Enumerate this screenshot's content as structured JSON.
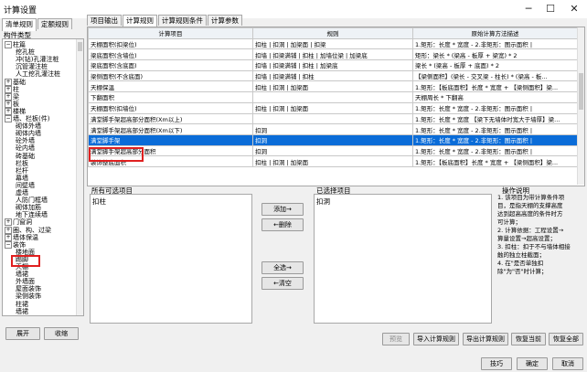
{
  "window": {
    "title": "计算设置",
    "min_icon": "minimize-icon",
    "max_icon": "maximize-icon",
    "close_icon": "close-icon"
  },
  "left_tabs": [
    "清单规则",
    "定额规则"
  ],
  "left_header": "构件类型",
  "tree": [
    {
      "label": "柱篇",
      "level": 0,
      "box": "−"
    },
    {
      "label": "挖孔桩",
      "level": 2
    },
    {
      "label": "冲(钻)孔灌注桩",
      "level": 2
    },
    {
      "label": "沉管灌注桩",
      "level": 2
    },
    {
      "label": "人工挖孔灌注桩",
      "level": 2
    },
    {
      "label": "基础",
      "level": 0,
      "box": "+"
    },
    {
      "label": "柱",
      "level": 0,
      "box": "+"
    },
    {
      "label": "梁",
      "level": 0,
      "box": "+"
    },
    {
      "label": "板",
      "level": 0,
      "box": "+"
    },
    {
      "label": "楼梯",
      "level": 0,
      "box": "+"
    },
    {
      "label": "墙、栏板(件)",
      "level": 0,
      "box": "−"
    },
    {
      "label": "砌体外墙",
      "level": 2
    },
    {
      "label": "砌体内墙",
      "level": 2
    },
    {
      "label": "砼外墙",
      "level": 2
    },
    {
      "label": "砼内墙",
      "level": 2
    },
    {
      "label": "砖基础",
      "level": 2
    },
    {
      "label": "栏板",
      "level": 2
    },
    {
      "label": "栏杆",
      "level": 2
    },
    {
      "label": "幕墙",
      "level": 2
    },
    {
      "label": "间壁墙",
      "level": 2
    },
    {
      "label": "虚墙",
      "level": 2
    },
    {
      "label": "人防门框墙",
      "level": 2
    },
    {
      "label": "砌体加筋",
      "level": 2
    },
    {
      "label": "地下连续墙",
      "level": 2
    },
    {
      "label": "门窗洞",
      "level": 0,
      "box": "+"
    },
    {
      "label": "圈、构、过梁",
      "level": 0,
      "box": "+"
    },
    {
      "label": "墙体保温",
      "level": 0,
      "box": "+"
    },
    {
      "label": "装饰",
      "level": 0,
      "box": "−"
    },
    {
      "label": "楼地面",
      "level": 2
    },
    {
      "label": "踢脚",
      "level": 2
    },
    {
      "label": "天棚",
      "level": 2
    },
    {
      "label": "墙裙",
      "level": 2
    },
    {
      "label": "外墙面",
      "level": 2
    },
    {
      "label": "屋面装饰",
      "level": 2
    },
    {
      "label": "梁侧装饰",
      "level": 2
    },
    {
      "label": "柱裙",
      "level": 2
    },
    {
      "label": "墙裙",
      "level": 2
    }
  ],
  "left_buttons": {
    "expand": "展开",
    "collapse": "收缩"
  },
  "right_tabs": [
    "项目输出",
    "计算规则",
    "计算规则条件",
    "计算参数"
  ],
  "grid": {
    "headers": [
      "计算项目",
      "规则",
      "原始计算方法描述"
    ],
    "rows": [
      [
        "天棚面积(扣梁位)",
        "扣柱 | 扣洞 | 加梁面 | 扣梁",
        "1.矩形：长度 * 宽度 - 2.非矩形：图示面积 |"
      ],
      [
        "梁底面积(含墙位)",
        "扣墙 | 扣梁满铺 | 扣柱 | 加墙位梁 | 加梁底",
        "矩形：梁长 * (梁高 - 板厚 + 梁宽) * 2"
      ],
      [
        "梁底面积(含底面)",
        "扣墙 | 扣梁满铺 | 扣柱 | 加梁底",
        "梁长 * (梁高 - 板厚 + 底面) * 2"
      ],
      [
        "梁侧面积(不含底面)",
        "扣墙 | 扣梁满铺 | 扣柱",
        "【梁侧面积】(梁长 - 交叉梁 - 柱长) * (梁高 - 板..."
      ],
      [
        "天棚保温",
        "扣柱 | 扣洞 | 加梁面",
        "1.矩形：【板底面积】长度 * 宽度 + 【梁侧面积】梁..."
      ],
      [
        "下翻面积",
        "",
        "天棚周长 * 下翻高"
      ],
      [
        "天棚面积(扣墙位)",
        "扣柱 | 扣洞 | 加梁面",
        "1.矩形：长度 * 宽度 - 2.非矩形：图示面积 |"
      ],
      [
        "满堂脚手架超高部分面积(Xm以上)",
        "",
        "1.矩形：长度 * 宽度 【梁下无墙体时宽大于墙厚】梁..."
      ],
      [
        "满堂脚手架超高部分面积(Xm以下)",
        "扣洞",
        "1.矩形：长度 * 宽度 - 2.非矩形：图示面积 |"
      ],
      [
        "满堂脚手架",
        "扣洞",
        "1.矩形：长度 * 宽度 - 2.非矩形：图示面积 |"
      ],
      [
        "满堂脚手架超高部分面积",
        "扣洞",
        "1.矩形：长度 * 宽度 - 2.非矩形：图示面积 |"
      ],
      [
        "装饰整底面积",
        "扣柱 | 扣洞 | 加梁面",
        "1.矩形：【板底面积】长度 * 宽度 + 【梁侧面积】梁..."
      ]
    ],
    "selected_row": 9
  },
  "available": {
    "label": "所有可选项目",
    "items": [
      "扣柱"
    ]
  },
  "selected": {
    "label": "已选择项目",
    "items": [
      "扣洞"
    ]
  },
  "middle_buttons": {
    "add": "添加→",
    "remove": "←删除",
    "add_all": "全选→",
    "clear": "←清空"
  },
  "help": {
    "title": "操作说明",
    "lines": [
      "1. 该项目为带计算条件项",
      "目，是指天棚的支撑高度",
      "达到超高高度的条件时方",
      "可计算；",
      "2. 计算依据：工程设置→",
      "算量设置→超高设置；",
      "3. 扣柱：扣于不与墙体相接",
      "触的独立柱截面；",
      "4. 在\"是否单独扣",
      "除\"为\"否\"时计算；"
    ]
  },
  "bottom_buttons": {
    "preview": "预览",
    "import": "导入计算规则",
    "export": "导出计算规则",
    "restore": "恢复当前",
    "restore_all": "恢复全部"
  },
  "footer_buttons": {
    "tips": "技巧",
    "ok": "确定",
    "cancel": "取消"
  }
}
